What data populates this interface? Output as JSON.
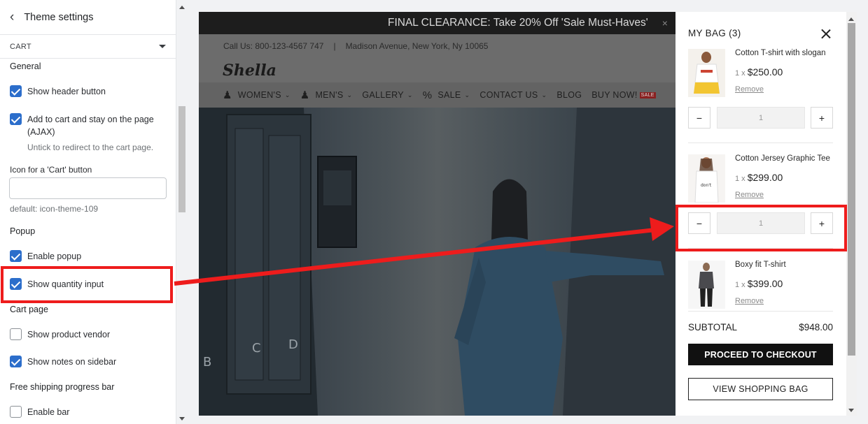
{
  "panel": {
    "back_icon": "chevron-left-icon",
    "title": "Theme settings",
    "section": "CART",
    "group_general": "General",
    "show_header_button": "Show header button",
    "add_to_cart_line1": "Add to cart and stay on the page",
    "add_to_cart_line2": "(AJAX)",
    "add_to_cart_hint": "Untick to redirect to the cart page.",
    "icon_label": "Icon for a 'Cart' button",
    "icon_value": "",
    "icon_default": "default: icon-theme-109",
    "group_popup": "Popup",
    "enable_popup": "Enable popup",
    "show_quantity_input": "Show quantity input",
    "group_cart_page": "Cart page",
    "show_product_vendor": "Show product vendor",
    "show_notes_sidebar": "Show notes on sidebar",
    "group_free_shipping": "Free shipping progress bar",
    "enable_bar": "Enable bar",
    "checked": {
      "show_header_button": true,
      "add_to_cart": true,
      "enable_popup": true,
      "show_quantity_input": true,
      "show_product_vendor": false,
      "show_notes_sidebar": true,
      "enable_bar": false
    }
  },
  "preview": {
    "promo": "FINAL CLEARANCE: Take 20% Off 'Sale Must-Haves'",
    "promo_close": "×",
    "contact_phone": "Call Us: 800-123-4567 747",
    "contact_sep": "|",
    "contact_address": "Madison Avenue, New York, Ny 10065",
    "logo": "Shella",
    "nav": {
      "womens": "WOMEN'S",
      "mens": "MEN'S",
      "gallery": "GALLERY",
      "sale": "SALE",
      "contact": "CONTACT US",
      "blog": "BLOG",
      "buy_now": "BUY NOW!",
      "sale_tag": "SALE"
    }
  },
  "cart": {
    "title": "MY BAG (3)",
    "items": [
      {
        "name": "Cotton T-shirt with slogan",
        "qty_prefix": "1 x",
        "price": "$250.00",
        "remove": "Remove",
        "quantity": "1"
      },
      {
        "name": "Cotton Jersey Graphic Tee",
        "qty_prefix": "1 x",
        "price": "$299.00",
        "remove": "Remove",
        "quantity": "1"
      },
      {
        "name": "Boxy fit T-shirt",
        "qty_prefix": "1 x",
        "price": "$399.00",
        "remove": "Remove"
      }
    ],
    "minus": "−",
    "plus": "+",
    "subtotal_label": "SUBTOTAL",
    "subtotal_value": "$948.00",
    "checkout": "PROCEED TO CHECKOUT",
    "view_bag": "VIEW SHOPPING BAG"
  },
  "colors": {
    "accent": "#2c6ecb",
    "annotation": "#ee1c1c",
    "checkout_button": "#111111"
  }
}
